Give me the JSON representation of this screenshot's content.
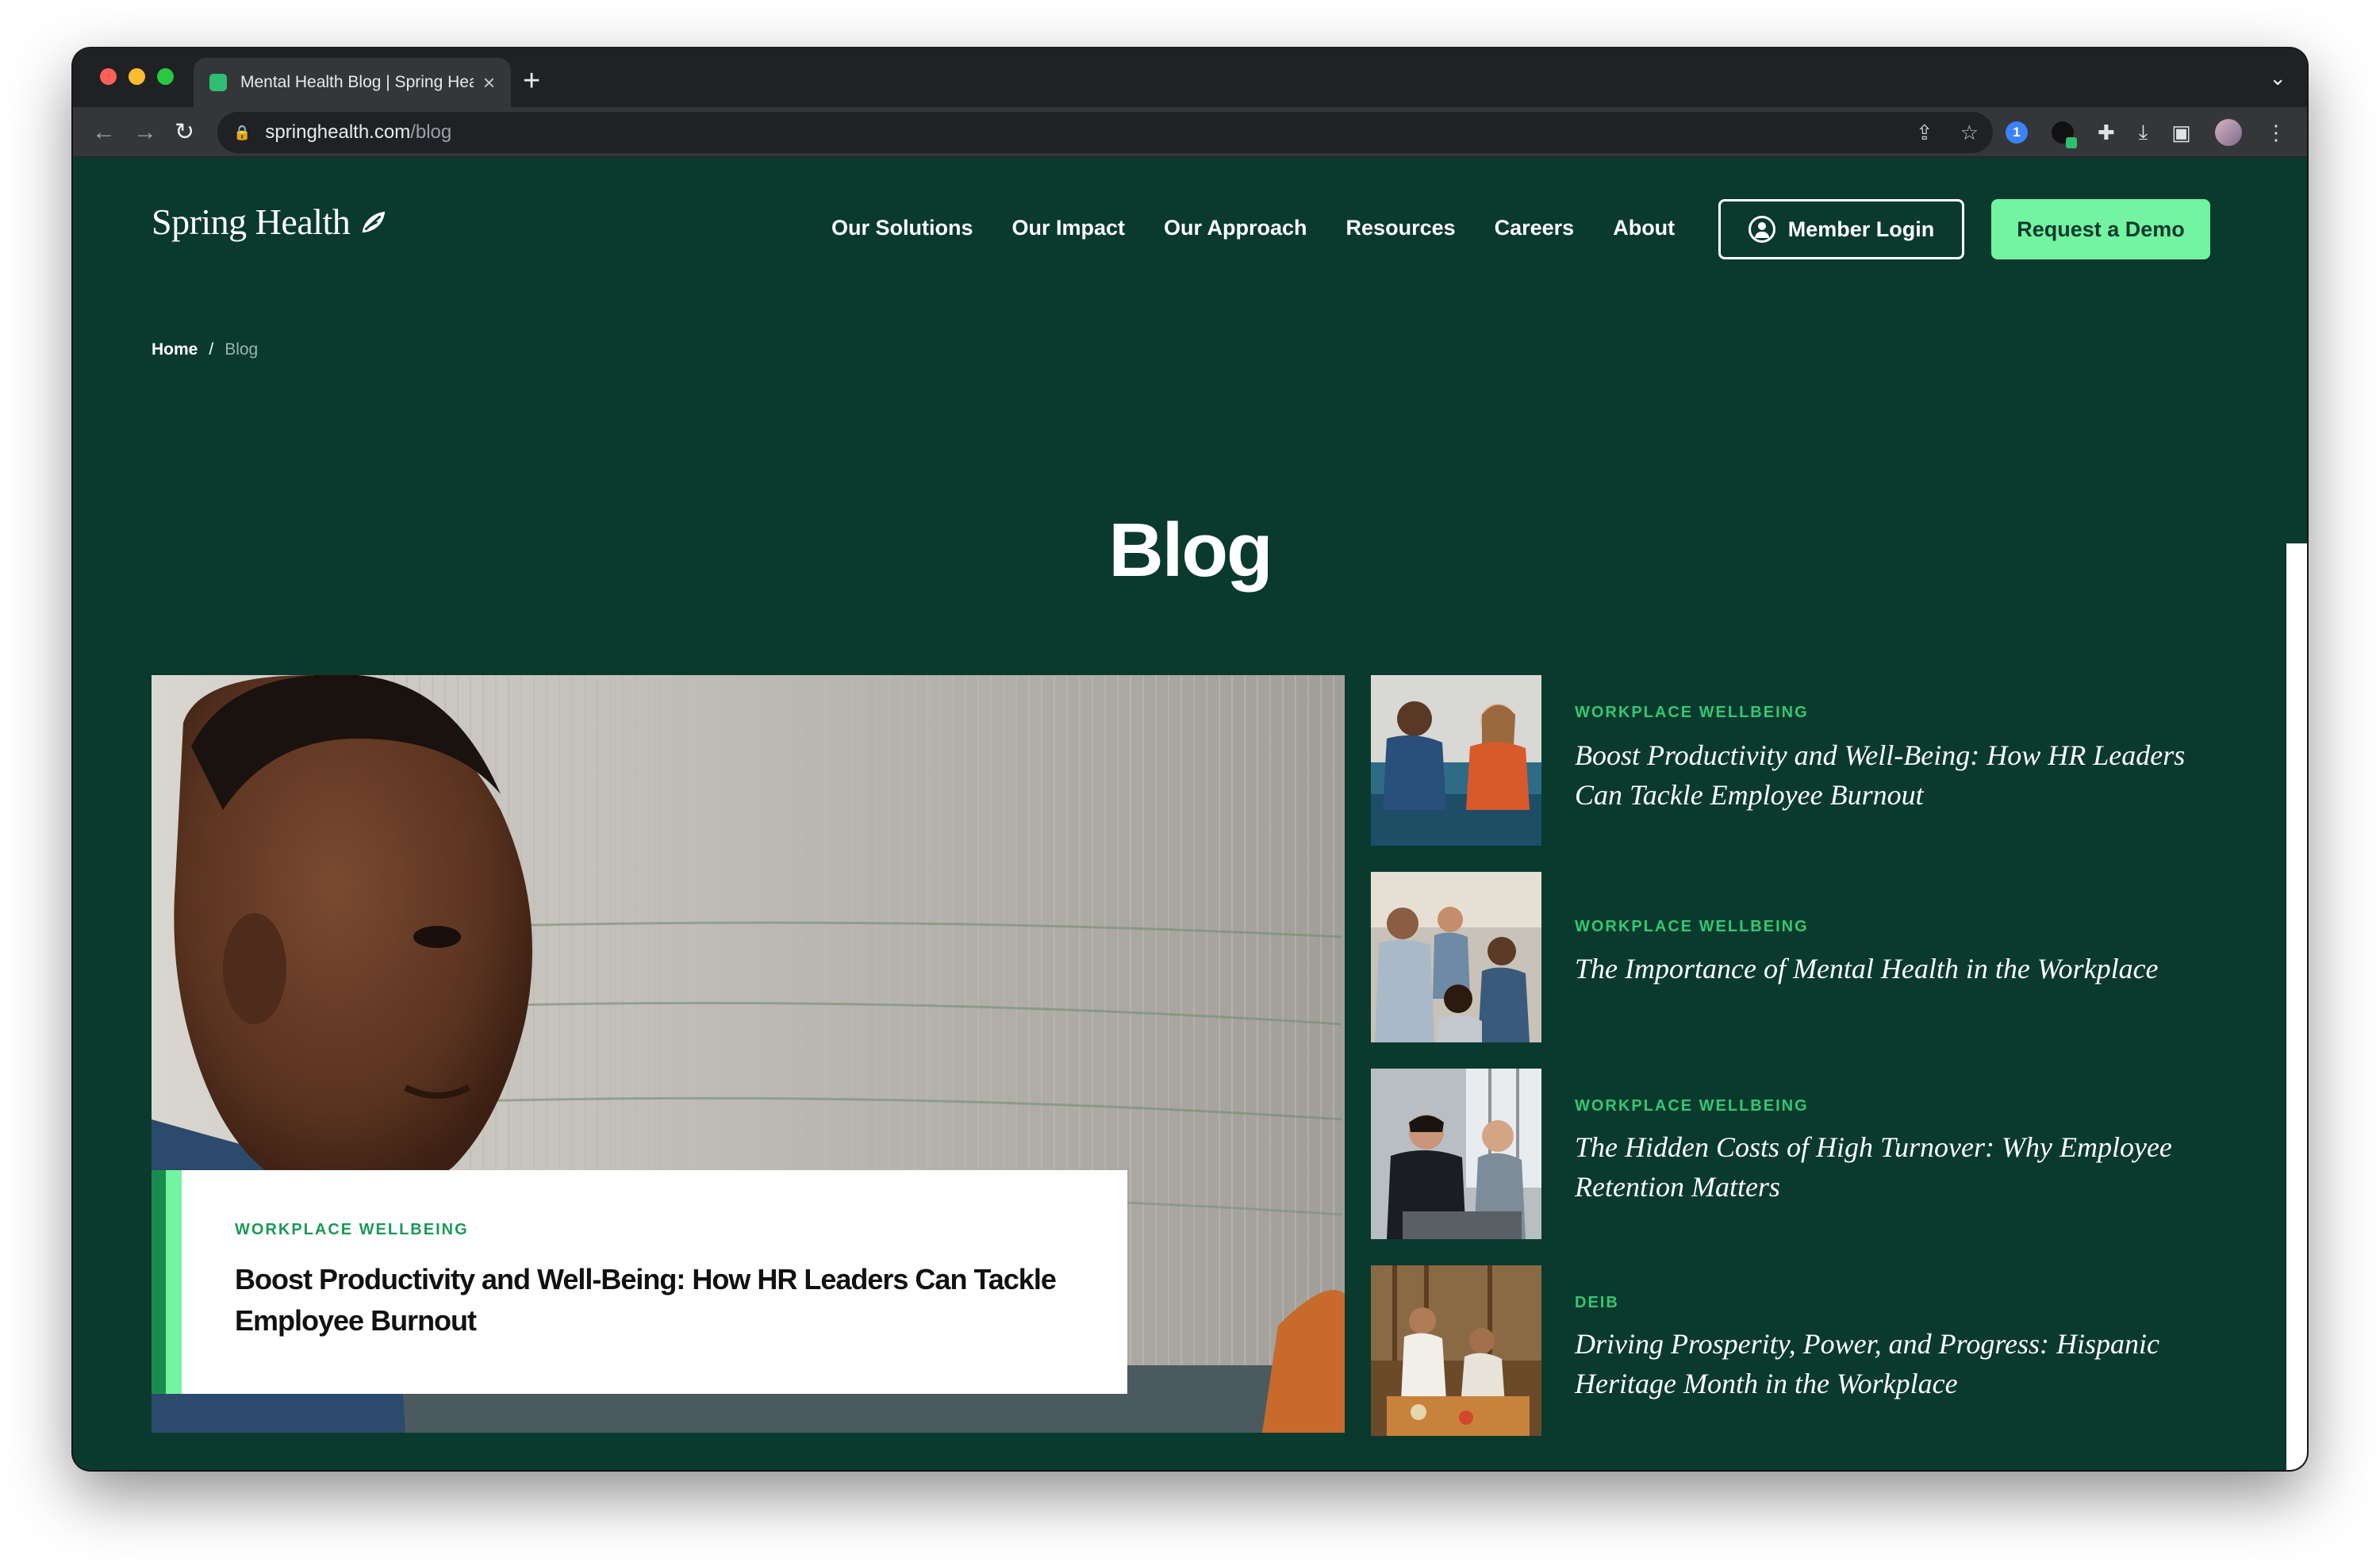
{
  "browser": {
    "tab_title": "Mental Health Blog | Spring Health",
    "tab_close": "×",
    "new_tab": "+",
    "tab_menu": "⌄",
    "url_host": "springhealth.com",
    "url_path": "/blog",
    "traffic_light_colors": [
      "#ff5f57",
      "#febc2e",
      "#28c840"
    ]
  },
  "site": {
    "logo_text": "Spring Health",
    "nav": [
      "Our Solutions",
      "Our Impact",
      "Our Approach",
      "Resources",
      "Careers",
      "About"
    ],
    "member_login": "Member Login",
    "request_demo": "Request a Demo"
  },
  "breadcrumb": {
    "home": "Home",
    "separator": "/",
    "current": "Blog"
  },
  "page_title": "Blog",
  "featured": {
    "tag": "WORKPLACE WELLBEING",
    "title": "Boost Productivity and Well-Being: How HR Leaders Can Tackle Employee Burnout"
  },
  "articles": [
    {
      "tag": "WORKPLACE WELLBEING",
      "title": "Boost Productivity and Well-Being: How HR Leaders Can Tackle Employee Burnout"
    },
    {
      "tag": "WORKPLACE WELLBEING",
      "title": "The Importance of Mental Health in the Workplace"
    },
    {
      "tag": "WORKPLACE WELLBEING",
      "title": "The Hidden Costs of High Turnover: Why Employee Retention Matters"
    },
    {
      "tag": "DEIB",
      "title": "Driving Prosperity, Power, and Progress: Hispanic Heritage Month in the Workplace"
    }
  ],
  "colors": {
    "page_bg": "#0a3a2e",
    "accent_green": "#74f3a1",
    "tag_green": "#33c871",
    "dark_tag_green": "#1a9a56"
  }
}
